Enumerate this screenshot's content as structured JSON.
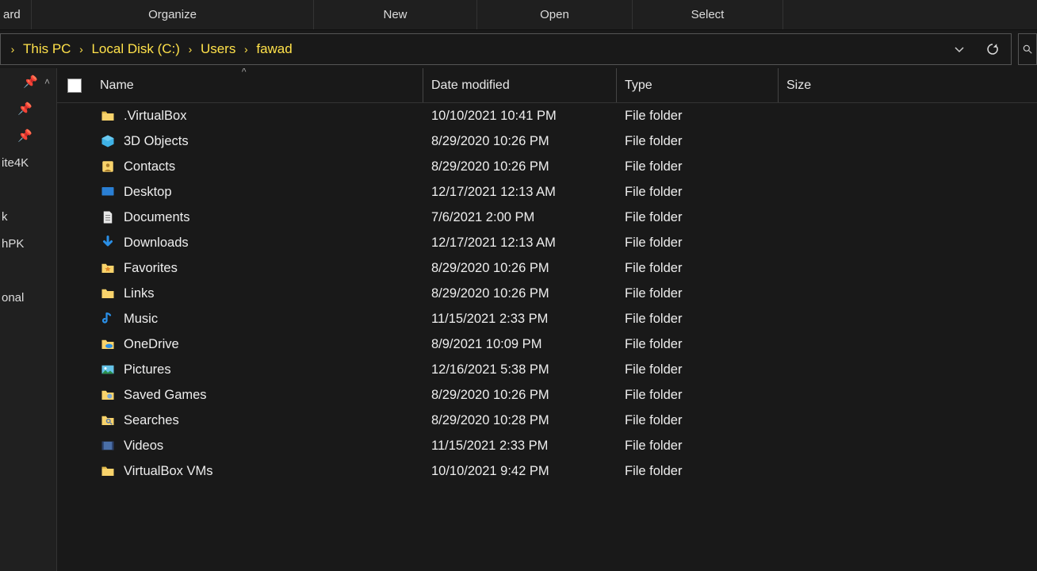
{
  "ribbon": {
    "tabs": [
      "ard",
      "Organize",
      "New",
      "Open",
      "Select"
    ]
  },
  "breadcrumbs": [
    "This PC",
    "Local Disk (C:)",
    "Users",
    "fawad"
  ],
  "nav": {
    "labels": [
      "ite4K",
      "k",
      "hPK",
      "onal"
    ]
  },
  "columns": {
    "name": "Name",
    "date": "Date modified",
    "type": "Type",
    "size": "Size"
  },
  "rows": [
    {
      "icon": "folder",
      "name": ".VirtualBox",
      "date": "10/10/2021 10:41 PM",
      "type": "File folder",
      "size": ""
    },
    {
      "icon": "objects3d",
      "name": "3D Objects",
      "date": "8/29/2020 10:26 PM",
      "type": "File folder",
      "size": ""
    },
    {
      "icon": "contacts",
      "name": "Contacts",
      "date": "8/29/2020 10:26 PM",
      "type": "File folder",
      "size": ""
    },
    {
      "icon": "desktop",
      "name": "Desktop",
      "date": "12/17/2021 12:13 AM",
      "type": "File folder",
      "size": ""
    },
    {
      "icon": "documents",
      "name": "Documents",
      "date": "7/6/2021 2:00 PM",
      "type": "File folder",
      "size": ""
    },
    {
      "icon": "downloads",
      "name": "Downloads",
      "date": "12/17/2021 12:13 AM",
      "type": "File folder",
      "size": ""
    },
    {
      "icon": "favorites",
      "name": "Favorites",
      "date": "8/29/2020 10:26 PM",
      "type": "File folder",
      "size": ""
    },
    {
      "icon": "links",
      "name": "Links",
      "date": "8/29/2020 10:26 PM",
      "type": "File folder",
      "size": ""
    },
    {
      "icon": "music",
      "name": "Music",
      "date": "11/15/2021 2:33 PM",
      "type": "File folder",
      "size": ""
    },
    {
      "icon": "onedrive",
      "name": "OneDrive",
      "date": "8/9/2021 10:09 PM",
      "type": "File folder",
      "size": ""
    },
    {
      "icon": "pictures",
      "name": "Pictures",
      "date": "12/16/2021 5:38 PM",
      "type": "File folder",
      "size": ""
    },
    {
      "icon": "saved",
      "name": "Saved Games",
      "date": "8/29/2020 10:26 PM",
      "type": "File folder",
      "size": ""
    },
    {
      "icon": "searches",
      "name": "Searches",
      "date": "8/29/2020 10:28 PM",
      "type": "File folder",
      "size": ""
    },
    {
      "icon": "videos",
      "name": "Videos",
      "date": "11/15/2021 2:33 PM",
      "type": "File folder",
      "size": ""
    },
    {
      "icon": "folder",
      "name": "VirtualBox VMs",
      "date": "10/10/2021 9:42 PM",
      "type": "File folder",
      "size": ""
    }
  ]
}
